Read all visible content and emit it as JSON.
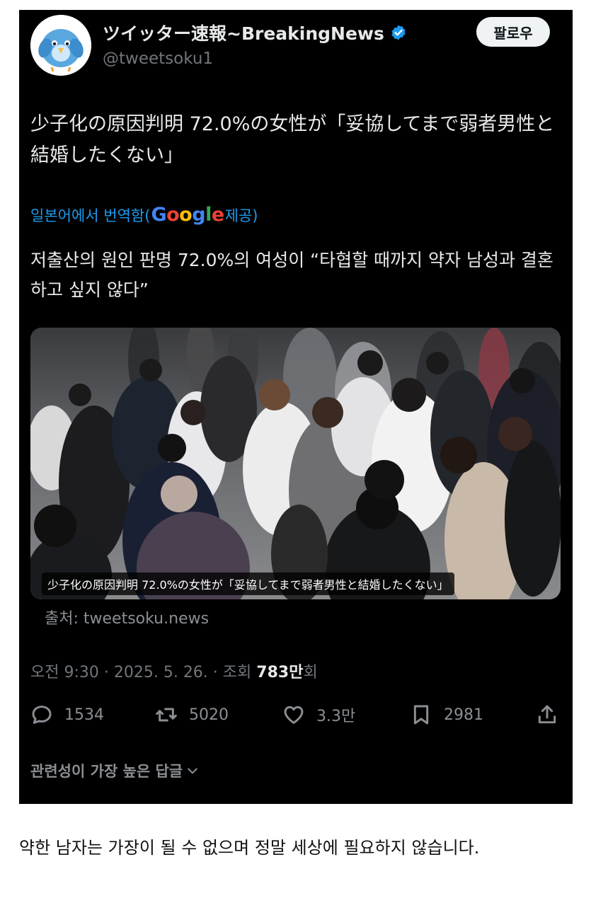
{
  "tweet": {
    "display_name": "ツイッター速報~BreakingNews",
    "handle": "@tweetsoku1",
    "follow_label": "팔로우",
    "text": "少子化の原因判明 72.0%の女性が「妥協してまで弱者男性と結婚したくない」",
    "translated_prefix": "일본어에서 번역함(",
    "translated_brand": "Google",
    "translated_suffix": " 제공)",
    "translation": "저출산의 원인 판명 72.0%의 여성이 “타협할 때까지 약자 남성과 결혼하고 싶지 않다”",
    "image_caption": "少子化の原因判明 72.0%の女性が「妥協してまで弱者男性と結婚したくない」",
    "source": "출처: tweetsoku.news",
    "meta_prefix": "오전 9:30 · 2025. 5. 26. · 조회 ",
    "views": "783만",
    "meta_suffix": "회",
    "replies": "1534",
    "retweets": "5020",
    "likes": "3.3만",
    "bookmarks": "2981",
    "replies_filter": "관련성이 가장 높은 답글"
  },
  "post_comment": "약한 남자는 가장이 될 수 없으며 정말 세상에 필요하지 않습니다.",
  "colors": {
    "background": "#000000",
    "text": "#e7e9ea",
    "muted": "#71767b",
    "link": "#1d9bf0",
    "verified": "#1d9bf0",
    "google_blue": "#4285F4",
    "google_red": "#EA4335",
    "google_yellow": "#FBBC05",
    "google_green": "#34A853"
  },
  "icons": [
    "bird-avatar-icon",
    "verified-badge-icon",
    "reply-icon",
    "retweet-icon",
    "like-icon",
    "bookmark-icon",
    "share-icon",
    "chevron-down-icon"
  ]
}
